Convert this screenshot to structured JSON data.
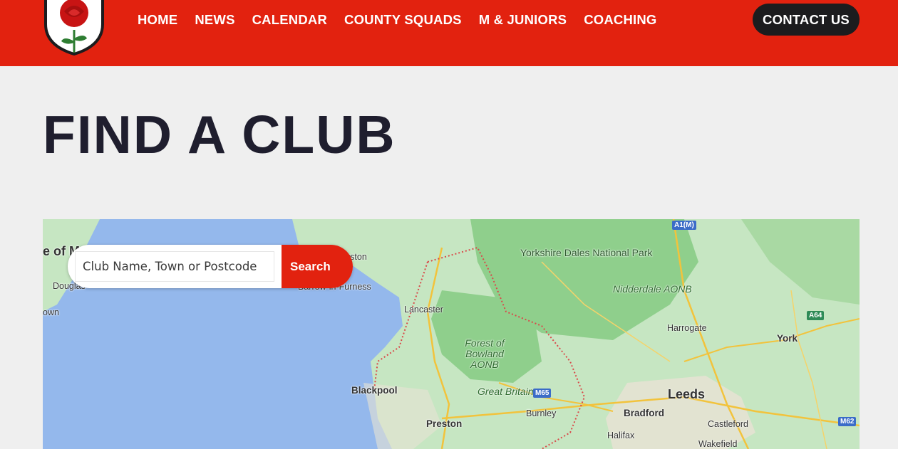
{
  "header": {
    "nav": [
      "HOME",
      "NEWS",
      "CALENDAR",
      "COUNTY SQUADS",
      "M & JUNIORS",
      "COACHING"
    ],
    "contact_label": "CONTACT US"
  },
  "page_title": "FIND A CLUB",
  "search": {
    "placeholder": "Club Name, Town or Postcode",
    "button_label": "Search"
  },
  "map": {
    "places": {
      "isle": "e of M",
      "douglas": "Douglas",
      "town": "own",
      "ulverston": "Ulverston",
      "barrow": "Barrow-in-Furness",
      "lancaster": "Lancaster",
      "blackpool": "Blackpool",
      "preston": "Preston",
      "great_britain": "Great Britain",
      "burnley": "Burnley",
      "bradford": "Bradford",
      "leeds": "Leeds",
      "harrogate": "Harrogate",
      "york": "York",
      "halifax": "Halifax",
      "castleford": "Castleford",
      "wakefield": "Wakefield",
      "yorkshire_dales": "Yorkshire Dales National Park",
      "nidderdale": "Nidderdale AONB",
      "bowland": "Forest of Bowland AONB"
    },
    "roads": [
      "A1(M)",
      "A64",
      "M65",
      "M62"
    ]
  }
}
